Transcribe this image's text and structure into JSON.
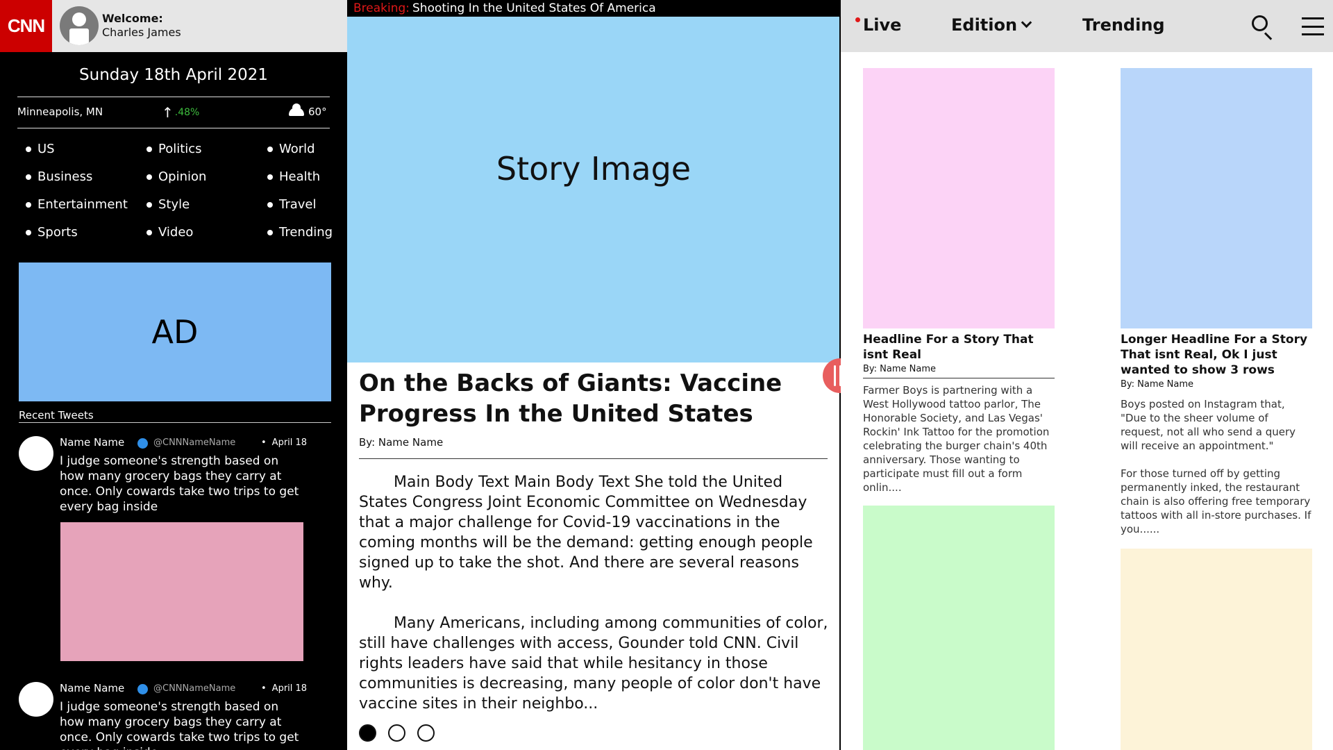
{
  "brand": {
    "logo_text": "CNN"
  },
  "user": {
    "welcome_label": "Welcome:",
    "name": "Charles James"
  },
  "sidebar": {
    "date": "Sunday 18th April 2021",
    "location": "Minneapolis, MN",
    "market_change": ".48%",
    "weather_temp": "60°",
    "categories": [
      "US",
      "Politics",
      "World",
      "Business",
      "Opinion",
      "Health",
      "Entertainment",
      "Style",
      "Travel",
      "Sports",
      "Video",
      "Trending"
    ],
    "ad_label": "AD",
    "tweets_title": "Recent Tweets",
    "tweets": [
      {
        "name": "Name Name",
        "handle": "@CNNNameName",
        "date": "April 18",
        "text": "I judge someone's strength based on how many grocery bags they carry at once. Only cowards take two trips to get every bag inside"
      },
      {
        "name": "Name Name",
        "handle": "@CNNNameName",
        "date": "April 18",
        "text": "I judge someone's strength based on how many grocery bags they carry at once. Only cowards take two trips to get every bag inside"
      }
    ]
  },
  "breaking": {
    "label": "Breaking:",
    "text": "Shooting In the United States Of America"
  },
  "main_story": {
    "image_label": "Story Image",
    "headline": "On the Backs of Giants: Vaccine Progress In the United States",
    "byline": "By: Name Name",
    "paragraphs": [
      "Main Body Text Main Body Text She told the United States Congress Joint Economic Committee on Wednesday that a major challenge for Covid-19 vaccinations in the coming months will be the demand: getting enough people signed up to take the shot. And there are several reasons why.",
      "Many Americans, including among communities of color, still have challenges with access, Gounder told CNN. Civil rights leaders have said that while hesitancy in those communities is decreasing, many people of color don't have vaccine sites in their neighbo..."
    ]
  },
  "topnav": {
    "live": "Live",
    "edition": "Edition",
    "trending": "Trending"
  },
  "cards": [
    {
      "headline": "Headline For a Story That isnt Real",
      "byline": "By: Name Name",
      "body": "Farmer Boys is partnering with a West Hollywood tattoo parlor, The Honorable Society, and Las Vegas' Rockin' Ink Tattoo for the promotion celebrating the burger chain's 40th anniversary. Those wanting to participate must fill out a form onlin...."
    },
    {
      "headline": "Longer Headline For a Story That isnt Real, Ok I just wanted to show 3 rows",
      "byline": "By: Name Name",
      "body": " Boys posted on Instagram that, \"Due to the sheer volume of request, not all who send a query will receive an appointment.\"\n\nFor those turned off by getting permanently inked, the restaurant chain is also offering free temporary tattoos with all in-store purchases. If you......"
    }
  ],
  "colors": {
    "brand_red": "#cc0000",
    "breaking_red": "#e01818",
    "ad_blue": "#7db9f3",
    "story_image_blue": "#9ad6f7",
    "tweet_image_pink": "#e6a3ba",
    "card_pink": "#fcd3f6",
    "card_blue": "#b9d6fa",
    "card_green": "#c9fbca",
    "card_cream": "#fdf3d8",
    "handle_red": "#e85e5e"
  }
}
